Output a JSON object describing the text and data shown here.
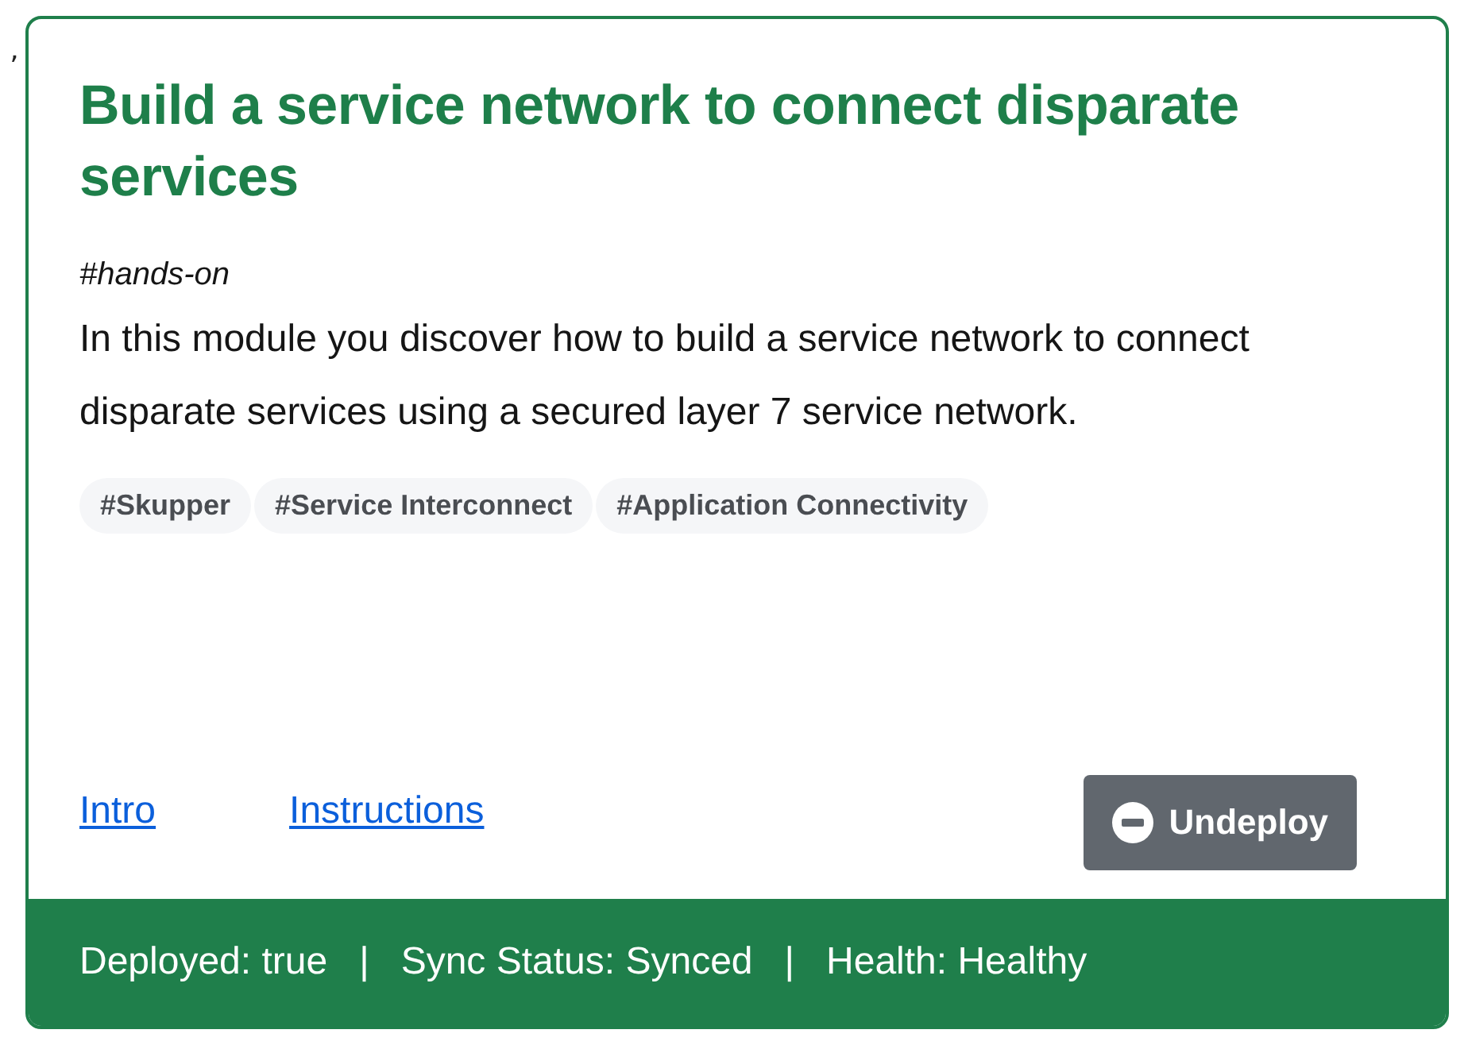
{
  "stray_mark": "’",
  "card": {
    "title": "Build a service network to connect disparate services",
    "tag_line": "#hands-on",
    "description": "In this module you discover how to build a service network to connect disparate services using a secured layer 7 service network.",
    "tags": [
      "#Skupper",
      "#Service Interconnect",
      "#Application Connectivity"
    ],
    "links": [
      "Intro",
      "Instructions"
    ],
    "button": {
      "label": "Undeploy"
    },
    "status": [
      "Deployed: true",
      "|",
      "Sync Status: Synced",
      "|",
      "Health: Healthy"
    ]
  }
}
